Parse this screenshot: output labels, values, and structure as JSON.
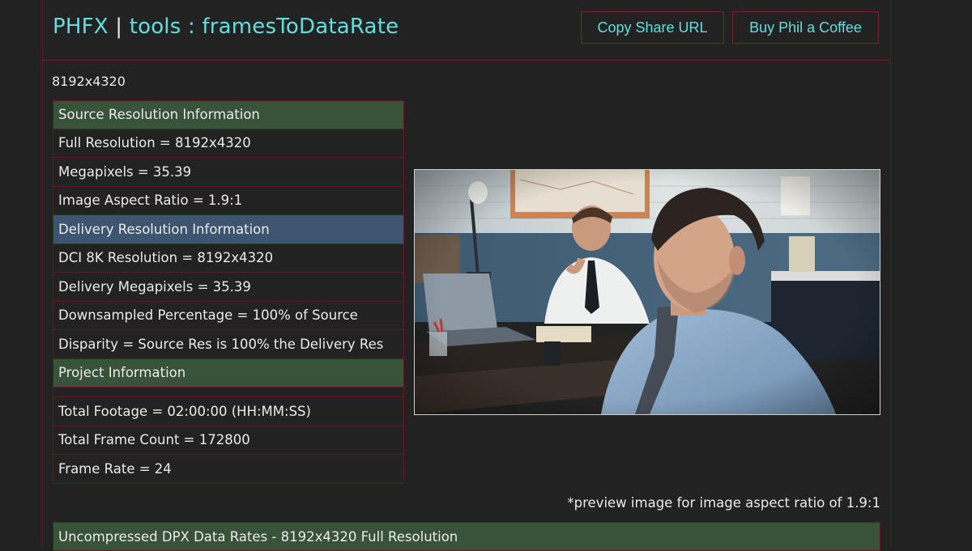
{
  "header": {
    "brand": "PHFX",
    "separator": "|",
    "page": "tools : framesToDataRate",
    "copy_share_label": "Copy Share URL",
    "coffee_label": "Buy Phil a Coffee"
  },
  "resolution_label": "8192x4320",
  "info": {
    "source_heading": "Source Resolution Information",
    "full_resolution": "Full Resolution = 8192x4320",
    "megapixels": "Megapixels = 35.39",
    "aspect_ratio": "Image Aspect Ratio = 1.9:1",
    "delivery_heading": "Delivery Resolution Information",
    "dci_resolution": "DCI 8K Resolution = 8192x4320",
    "delivery_megapixels": "Delivery Megapixels = 35.39",
    "downsampled": "Downsampled Percentage = 100% of Source",
    "disparity": "Disparity = Source Res is 100% the Delivery Res",
    "project_heading": "Project Information",
    "total_footage": "Total Footage = 02:00:00 (HH:MM:SS)",
    "total_frames": "Total Frame Count = 172800",
    "frame_rate": "Frame Rate = 24"
  },
  "preview_caption": "*preview image for image aspect ratio of 1.9:1",
  "dpx_heading": "Uncompressed DPX Data Rates - 8192x4320 Full Resolution",
  "colors": {
    "accent": "#62dede",
    "border": "#5a1e1e",
    "heading_green": "#385339",
    "heading_blue": "#3d556e",
    "background": "#222222"
  }
}
